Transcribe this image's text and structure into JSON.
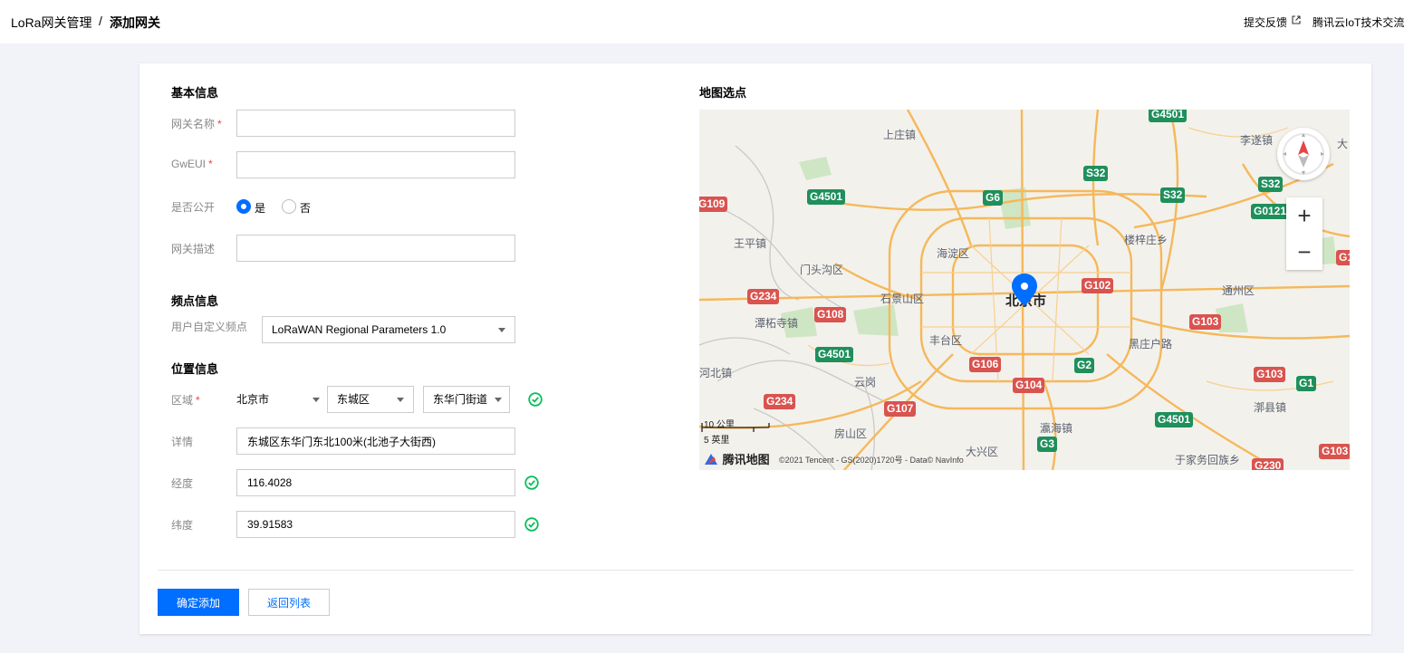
{
  "breadcrumb": {
    "parent": "LoRa网关管理",
    "separator": "/",
    "current": "添加网关"
  },
  "top_links": {
    "feedback": "提交反馈",
    "community": "腾讯云IoT技术交流"
  },
  "basic": {
    "title": "基本信息",
    "name_label": "网关名称",
    "gweui_label": "GwEUI",
    "public_label": "是否公开",
    "public_yes": "是",
    "public_no": "否",
    "public_selected": "是",
    "desc_label": "网关描述",
    "required_mark": "*"
  },
  "freq": {
    "title": "频点信息",
    "label": "用户自定义频点",
    "value": "LoRaWAN Regional Parameters 1.0"
  },
  "location": {
    "title": "位置信息",
    "region_label": "区域",
    "city": "北京市",
    "district": "东城区",
    "street": "东华门街道",
    "detail_label": "详情",
    "detail_value": "东城区东华门东北100米(北池子大街西)",
    "lng_label": "经度",
    "lng_value": "116.4028",
    "lat_label": "纬度",
    "lat_value": "39.91583"
  },
  "map": {
    "title": "地图选点",
    "center_label": "北京市",
    "places": [
      "上庄镇",
      "李遂镇",
      "王平镇",
      "海淀区",
      "楼梓庄乡",
      "门头沟区",
      "石景山区",
      "通州区",
      "潭柘寺镇",
      "丰台区",
      "黑庄户路",
      "河北镇",
      "云岗",
      "漷县镇",
      "房山区",
      "瀛海镇",
      "大兴区",
      "于家务回族乡",
      "大"
    ],
    "highways": [
      "G4501",
      "G109",
      "G4501",
      "G6",
      "S32",
      "S32",
      "S32",
      "G0121",
      "G1",
      "G234",
      "G108",
      "G102",
      "G103",
      "G4501",
      "G106",
      "G2",
      "G103",
      "G1",
      "G234",
      "G104",
      "G107",
      "G4501",
      "G3",
      "G103",
      "G230"
    ],
    "scale_metric": "10 公里",
    "scale_imperial": "5 英里",
    "logo": "腾讯地图",
    "copyright": "©2021 Tencent - GS(2020)1720号 - Data© NavInfo",
    "zoom_in": "+",
    "zoom_out": "−"
  },
  "actions": {
    "confirm": "确定添加",
    "back": "返回列表"
  },
  "colors": {
    "primary": "#006eff",
    "success": "#0abf5b",
    "required": "#e54545"
  }
}
